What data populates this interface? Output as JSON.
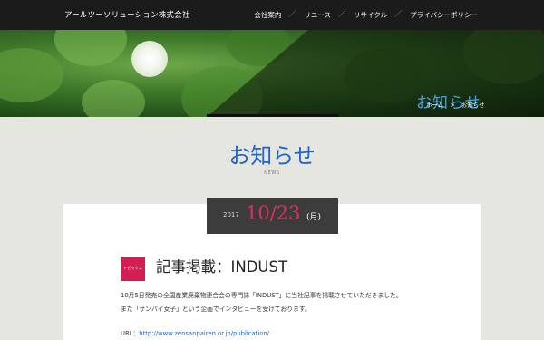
{
  "header": {
    "brand": "アールツーソリューション株式会社",
    "nav": [
      "会社案内",
      "リユース",
      "リサイクル",
      "プライバシーポリシー"
    ],
    "separator": "／"
  },
  "hero": {
    "title": "お知らせ",
    "breadcrumb": {
      "home": "ホーム",
      "arrow": ">",
      "current": "お知らせ"
    }
  },
  "page": {
    "title": "お知らせ",
    "subtitle": "NEWS"
  },
  "post": {
    "year": "2017",
    "date": "10/23",
    "weekday": "(月)",
    "category": "トピックス",
    "title": "記事掲載：INDUST",
    "body_line1": "10月5日発売の全国産業廃棄物連合会の専門誌「INDUST」に当社記事を掲載させていただきました。",
    "body_line2": "また「サンパイ女子」という企画でインタビューを受けております。",
    "url_label": "URL：",
    "url": "http://www.zensanpairen.or.jp/publication/"
  },
  "colors": {
    "accent_blue": "#1f64c6",
    "hero_title": "#4aa3e8",
    "date_red": "#e0305a",
    "category_bg": "#d21f53"
  }
}
